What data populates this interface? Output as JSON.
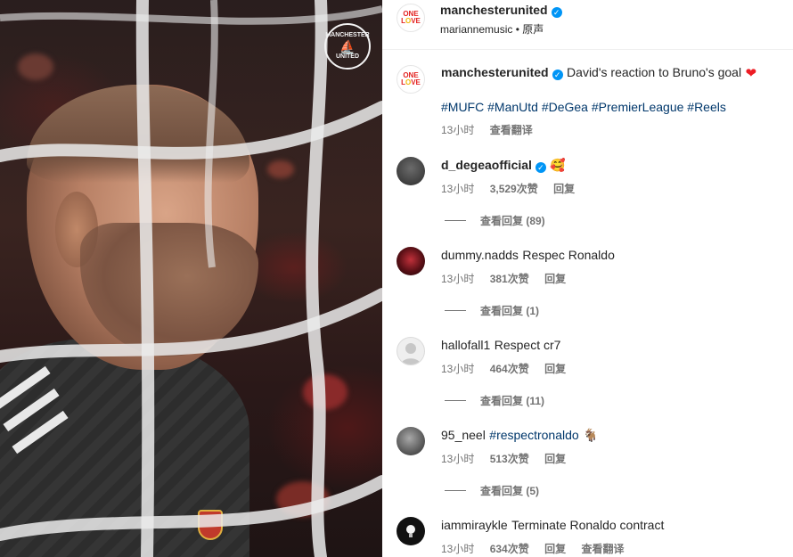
{
  "post": {
    "author": "manchesterunited",
    "audio_user": "mariannemusic",
    "audio_label": "原声",
    "caption_text": "David's reaction to Bruno's goal",
    "caption_emoji": "❤",
    "hashtags": [
      "#MUFC",
      "#ManUtd",
      "#DeGea",
      "#PremierLeague",
      "#Reels"
    ],
    "time": "13小时",
    "translate": "查看翻译"
  },
  "comments": [
    {
      "username": "d_degeaofficial",
      "verified": true,
      "text": "🥰",
      "time": "13小时",
      "likes": "3,529次赞",
      "reply": "回复",
      "view_replies": "查看回复 (89)"
    },
    {
      "username": "dummy.nadds",
      "verified": false,
      "text": "Respec Ronaldo",
      "time": "13小时",
      "likes": "381次赞",
      "reply": "回复",
      "view_replies": "查看回复 (1)"
    },
    {
      "username": "hallofall1",
      "verified": false,
      "text": "Respect cr7",
      "time": "13小时",
      "likes": "464次赞",
      "reply": "回复",
      "view_replies": "查看回复 (11)"
    },
    {
      "username": "95_neel",
      "verified": false,
      "text": "#respectronaldo",
      "text_suffix": "🐐",
      "time": "13小时",
      "likes": "513次赞",
      "reply": "回复",
      "view_replies": "查看回复 (5)"
    },
    {
      "username": "iammiraykle",
      "verified": false,
      "text": "Terminate Ronaldo contract",
      "time": "13小时",
      "likes": "634次赞",
      "reply": "回复",
      "translate": "查看翻译"
    }
  ],
  "video": {
    "crest_text_top": "MANCHESTER",
    "crest_text_bottom": "UNITED"
  },
  "colors": {
    "link": "#00376b",
    "verified": "#0095f6",
    "secondary_text": "#737373"
  }
}
